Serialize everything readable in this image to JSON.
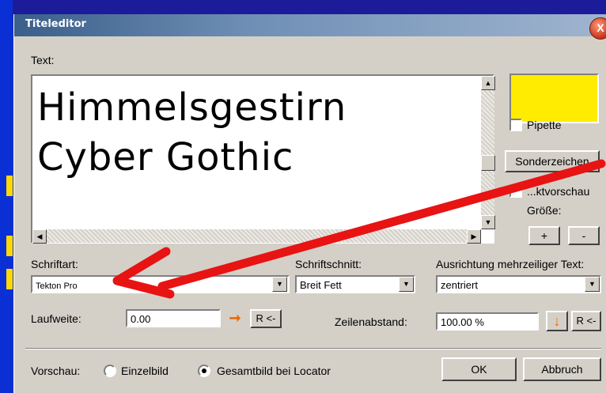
{
  "window": {
    "title": "Titeleditor",
    "close_glyph": "X"
  },
  "text_section": {
    "label": "Text:",
    "lines": [
      "Himmelsgestirn",
      "Cyber Gothic"
    ]
  },
  "color": {
    "swatch": "#ffec00"
  },
  "pipette": {
    "label": "Pipette",
    "checked": false
  },
  "special_chars_button": "Sonderzeichen",
  "preview_checkbox": {
    "label_partial": "...ktvorschau"
  },
  "size": {
    "label": "Größe:",
    "plus": "+",
    "minus": "-"
  },
  "font": {
    "label": "Schriftart:",
    "value": "Tekton Pro"
  },
  "style": {
    "label": "Schriftschnitt:",
    "value": "Breit Fett"
  },
  "alignment": {
    "label": "Ausrichtung mehrzeiliger Text:",
    "value": "zentriert"
  },
  "tracking": {
    "label": "Laufweite:",
    "value": "0.00",
    "reset": "R <-"
  },
  "line_spacing": {
    "label": "Zeilenabstand:",
    "value": "100.00 %",
    "reset": "R <-"
  },
  "preview": {
    "label": "Vorschau:",
    "options": [
      {
        "label": "Einzelbild",
        "selected": false
      },
      {
        "label": "Gesamtbild bei Locator",
        "selected": true
      }
    ]
  },
  "buttons": {
    "ok": "OK",
    "cancel": "Abbruch"
  },
  "colors": {
    "annotation_arrow": "#e81313",
    "accent_orange": "#f26a00"
  }
}
